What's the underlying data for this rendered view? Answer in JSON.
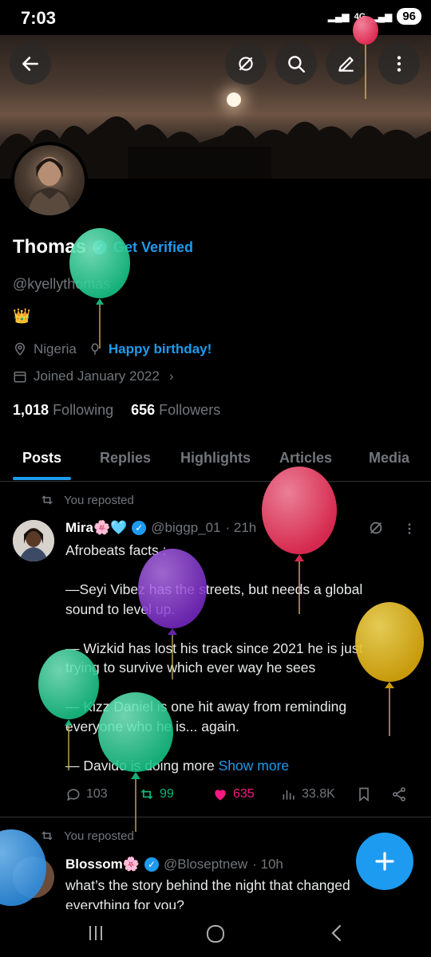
{
  "status": {
    "time": "7:03",
    "network": "4G",
    "battery": "96"
  },
  "profile": {
    "name": "Thomas",
    "get_verified": "Get Verified",
    "handle": "@kyellythomas",
    "bio_emoji": "👑",
    "location": "Nigeria",
    "birthday_link": "Happy birthday!",
    "joined": "Joined January 2022",
    "following_count": "1,018",
    "following_label": "Following",
    "followers_count": "656",
    "followers_label": "Followers"
  },
  "tabs": [
    "Posts",
    "Replies",
    "Highlights",
    "Articles",
    "Media"
  ],
  "posts": [
    {
      "repost_label": "You reposted",
      "author": "Mira🌸🩵",
      "handle": "@biggp_01",
      "time": "· 21h",
      "text": "Afrobeats facts :\n\n—Seyi Vibez has the streets, but needs a global sound to level up.\n\n— Wizkid  has lost his track since 2021 he is just trying to survive which ever  way he sees\n\n— Kizz Daniel is one hit away from reminding everyone who he is... again.\n\n— Davido is doing more ",
      "show_more": "Show more",
      "replies": "103",
      "reposts": "99",
      "likes": "635",
      "views": "33.8K"
    },
    {
      "repost_label": "You reposted",
      "author": "Blossom🌸",
      "handle": "@Bloseptnew",
      "time": "· 10h",
      "text": "what’s the story behind the night that changed everything for you?"
    }
  ],
  "colors": {
    "accent": "#1d9bf0",
    "like": "#f91880",
    "repost": "#00ba7c",
    "muted": "#71767b"
  }
}
